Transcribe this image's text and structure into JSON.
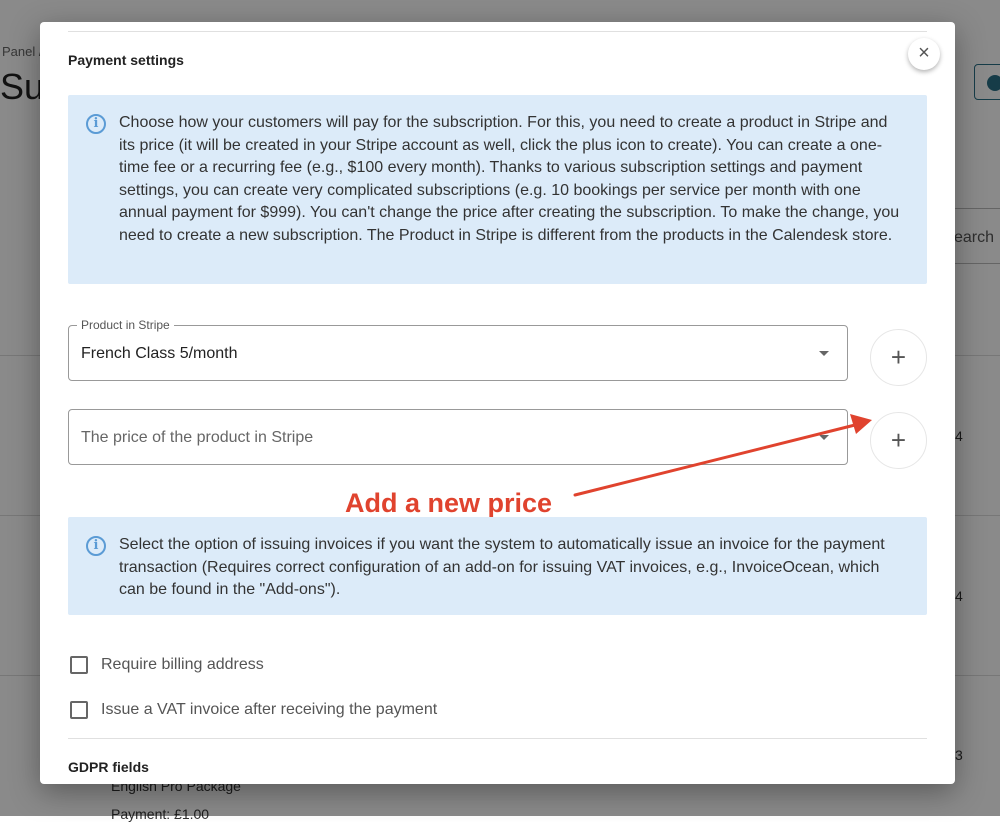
{
  "background": {
    "breadcrumb": "Panel /",
    "title": "Su",
    "search": "earch",
    "row_values": [
      "4",
      "4",
      "3"
    ],
    "package": "English Pro Package",
    "payment": "Payment: £1.00"
  },
  "modal": {
    "section_title": "Payment settings",
    "close_icon": "close-icon",
    "info1": "Choose how your customers will pay for the subscription. For this, you need to create a product in Stripe and its price (it will be created in your Stripe account as well, click the plus icon to create). You can create a one-time fee or a recurring fee (e.g., $100 every month). Thanks to various subscription settings and payment settings, you can create very complicated subscriptions (e.g. 10 bookings per service per month with one annual payment for $999). You can't change the price after creating the subscription. To make the change, you need to create a new subscription. The Product in Stripe is different from the products in the Calendesk store.",
    "product_label": "Product in Stripe",
    "product_value": "French Class 5/month",
    "price_placeholder": "The price of the product in Stripe",
    "annotation": "Add a new price",
    "annotation_color": "#e0432e",
    "info2": "Select the option of issuing invoices if you want the system to automatically issue an invoice for the payment transaction (Requires correct configuration of an add-on for issuing VAT invoices, e.g., InvoiceOcean, which can be found in the \"Add-ons\").",
    "checkbox1": {
      "label": "Require billing address",
      "checked": false
    },
    "checkbox2": {
      "label": "Issue a VAT invoice after receiving the payment",
      "checked": false
    },
    "gdpr_title": "GDPR fields"
  }
}
